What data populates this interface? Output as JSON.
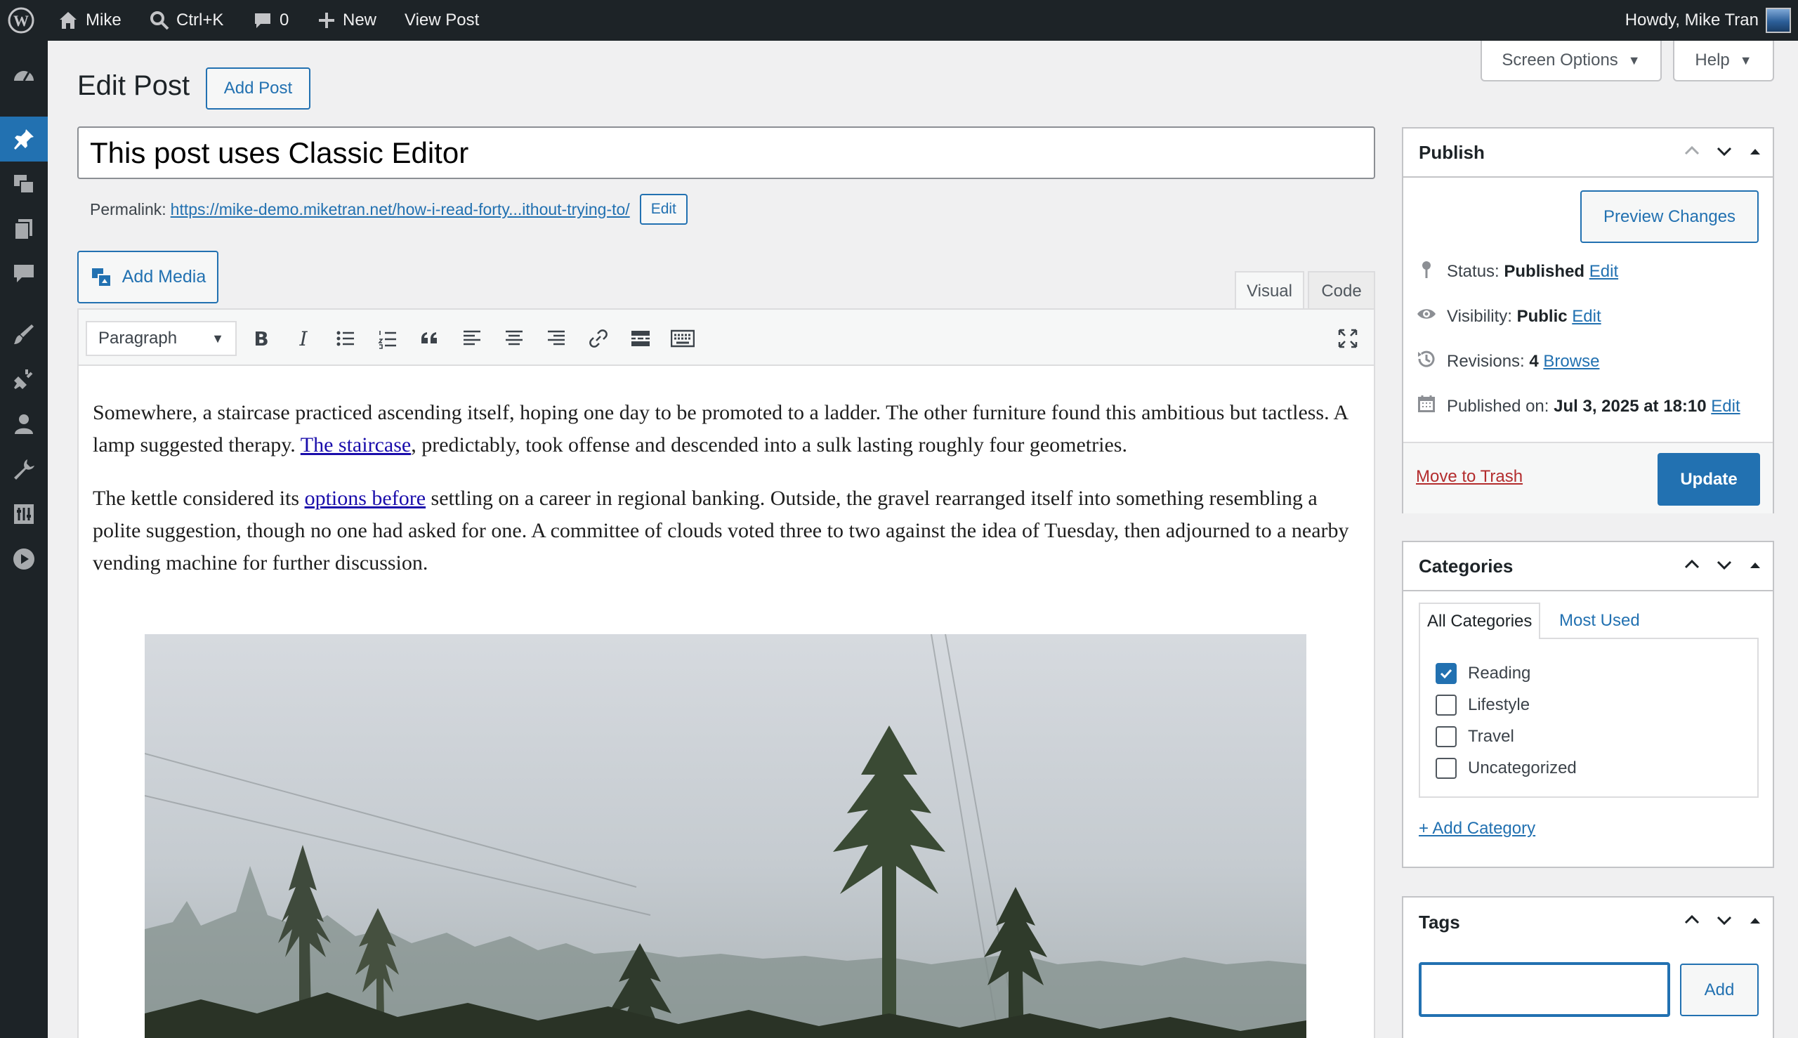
{
  "admin_bar": {
    "site_name": "Mike",
    "search_shortcut": "Ctrl+K",
    "comments_count": "0",
    "new_label": "New",
    "view_post_label": "View Post",
    "greeting": "Howdy, Mike Tran"
  },
  "screen_options": {
    "label": "Screen Options"
  },
  "help": {
    "label": "Help"
  },
  "page": {
    "heading": "Edit Post",
    "add_post_label": "Add Post",
    "title_value": "This post uses Classic Editor",
    "permalink_label": "Permalink:",
    "permalink_base": "https://mike-demo.miketran.net/",
    "permalink_slug": "how-i-read-forty...ithout-trying-to/",
    "permalink_edit": "Edit"
  },
  "editor": {
    "add_media_label": "Add Media",
    "tab_visual": "Visual",
    "tab_code": "Code",
    "format_select": "Paragraph",
    "p1_before": "Somewhere, a staircase practiced ascending itself, hoping one day to be promoted to a ladder. The other furniture found this ambitious but tactless. A lamp suggested therapy. ",
    "p1_link": "The staircase",
    "p1_after": ", predictably, took offense and descended into a sulk lasting roughly four geometries.",
    "p2_before": "The kettle considered its ",
    "p2_link": "options before",
    "p2_after": " settling on a career in regional banking. Outside, the gravel rearranged itself into something resembling a polite suggestion, though no one had asked for one. A committee of clouds voted three to two against the idea of Tuesday, then adjourned to a nearby vending machine for further discussion."
  },
  "publish": {
    "title": "Publish",
    "preview_label": "Preview Changes",
    "status_label": "Status:",
    "status_value": "Published",
    "visibility_label": "Visibility:",
    "visibility_value": "Public",
    "revisions_label": "Revisions:",
    "revisions_value": "4",
    "browse_label": "Browse",
    "published_label": "Published on:",
    "published_value": "Jul 3, 2025 at 18:10",
    "edit_label": "Edit",
    "trash_label": "Move to Trash",
    "update_label": "Update"
  },
  "categories": {
    "title": "Categories",
    "tab_all": "All Categories",
    "tab_most_used": "Most Used",
    "items": [
      {
        "label": "Reading",
        "checked": true
      },
      {
        "label": "Lifestyle",
        "checked": false
      },
      {
        "label": "Travel",
        "checked": false
      },
      {
        "label": "Uncategorized",
        "checked": false
      }
    ],
    "add_label": "+ Add Category"
  },
  "tags": {
    "title": "Tags",
    "input_value": "",
    "add_label": "Add"
  },
  "colors": {
    "accent": "#2271b1",
    "admin_bar_bg": "#1d2327",
    "trash": "#b32d2e"
  }
}
